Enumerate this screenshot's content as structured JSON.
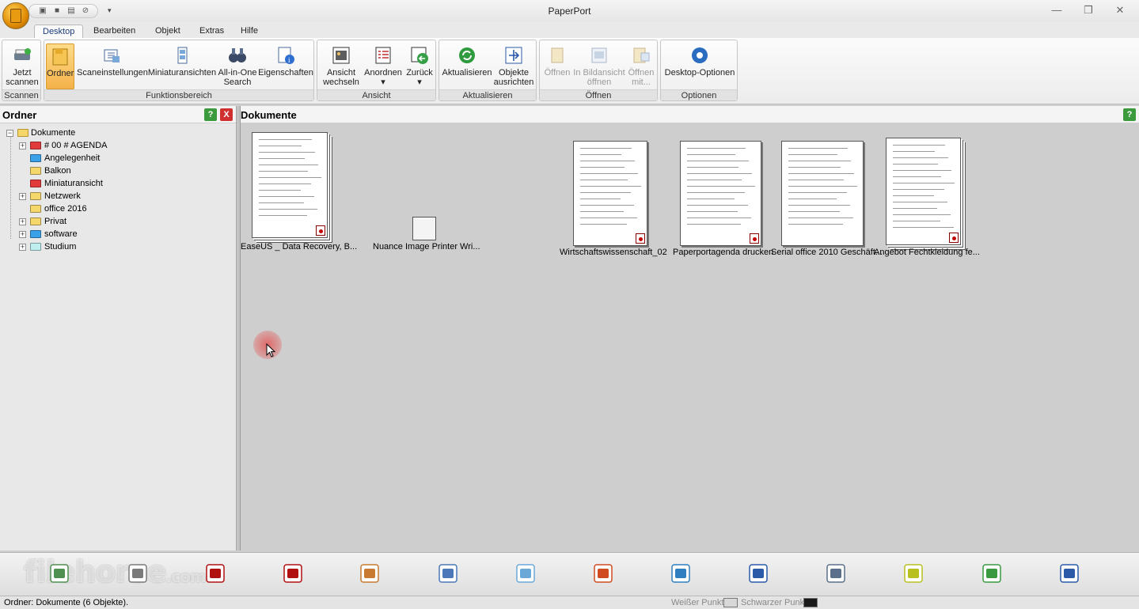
{
  "window": {
    "title": "PaperPort",
    "controls": [
      "minimize",
      "restore",
      "close"
    ]
  },
  "quick_access": {
    "icons": [
      "scan-icon",
      "folder-icon",
      "print-icon",
      "undo-icon"
    ],
    "more": "▾"
  },
  "ribbon": {
    "tabs": [
      {
        "label": "Desktop",
        "active": true
      },
      {
        "label": "Bearbeiten"
      },
      {
        "label": "Objekt"
      },
      {
        "label": "Extras"
      },
      {
        "label": "Hilfe"
      }
    ],
    "groups": {
      "scannen": {
        "label": "Scannen",
        "buttons": [
          {
            "label1": "Jetzt",
            "label2": "scannen"
          }
        ]
      },
      "funktionsbereich": {
        "label": "Funktionsbereich",
        "buttons": [
          {
            "label1": "Ordner",
            "selected": true
          },
          {
            "label1": "Scaneinstellungen"
          },
          {
            "label1": "Miniaturansichten"
          },
          {
            "label1": "All-in-One",
            "label2": "Search"
          },
          {
            "label1": "Eigenschaften"
          }
        ]
      },
      "ansicht": {
        "label": "Ansicht",
        "buttons": [
          {
            "label1": "Ansicht",
            "label2": "wechseln ▾"
          },
          {
            "label1": "Anordnen",
            "label2": "▾"
          },
          {
            "label1": "Zurück",
            "label2": "▾"
          }
        ]
      },
      "aktualisieren": {
        "label": "Aktualisieren",
        "buttons": [
          {
            "label1": "Aktualisieren"
          },
          {
            "label1": "Objekte",
            "label2": "ausrichten"
          }
        ]
      },
      "oeffnen": {
        "label": "Öffnen",
        "buttons": [
          {
            "label1": "Öffnen",
            "disabled": true
          },
          {
            "label1": "In Bildansicht",
            "label2": "öffnen",
            "disabled": true
          },
          {
            "label1": "Öffnen",
            "label2": "mit...",
            "disabled": true
          }
        ]
      },
      "optionen": {
        "label": "Optionen",
        "buttons": [
          {
            "label1": "Desktop-Optionen"
          }
        ]
      }
    }
  },
  "folder_pane": {
    "title": "Ordner",
    "help": "?",
    "close": "X",
    "root": {
      "label": "Dokumente",
      "expander": "−"
    },
    "items": [
      {
        "label": "# 00 # AGENDA",
        "color": "#e03a3a",
        "expander": "+"
      },
      {
        "label": "Angelegenheit",
        "color": "#3aa0e8",
        "expander": ""
      },
      {
        "label": "Balkon",
        "color": "#f4d66a",
        "expander": ""
      },
      {
        "label": "Miniaturansicht",
        "color": "#e03a3a",
        "expander": ""
      },
      {
        "label": "Netzwerk",
        "color": "#f4d66a",
        "expander": "+"
      },
      {
        "label": "office 2016",
        "color": "#f4d66a",
        "expander": ""
      },
      {
        "label": "Privat",
        "color": "#f4d66a",
        "expander": "+"
      },
      {
        "label": "software",
        "color": "#3aa0e8",
        "expander": "+"
      },
      {
        "label": "Studium",
        "color": "#bfeef0",
        "expander": "+"
      }
    ]
  },
  "doc_pane": {
    "title": "Dokumente",
    "help": "?",
    "documents": [
      {
        "caption": "EaseUS _ Data Recovery, B...",
        "type": "pdf-stack"
      },
      {
        "caption": "Nuance Image Printer Wri...",
        "type": "file"
      },
      {
        "caption": "Wirtschaftswissenschaft_02",
        "type": "pdf"
      },
      {
        "caption": "Paperportagenda drucken",
        "type": "pdf"
      },
      {
        "caption": "Serial office 2010 Geschäft...",
        "type": "doc"
      },
      {
        "caption": "Angebot Fechtkleidung fe...",
        "type": "pdf-stack"
      }
    ]
  },
  "send_to_bar": {
    "watermark": "filehorse",
    "watermark_suffix": ".com",
    "icons": [
      "scanner-app-icon",
      "satellite-dish-icon",
      "adobe-pdf-icon",
      "adobe-reader-icon",
      "paint-palette-icon",
      "text-document-icon",
      "notepad-icon",
      "powerpoint-icon",
      "globe-icon",
      "ftp-icon",
      "printer-icon",
      "hexagon-app-icon",
      "recycle-bin-icon",
      "image-converter-icon"
    ]
  },
  "status_bar": {
    "text": "Ordner: Dokumente (6 Objekte).",
    "white_dot_label": "Weißer Punkt",
    "black_dot_label": "Schwarzer Punkt",
    "white_color": "#d8d8d8",
    "black_color": "#1a1a1a"
  }
}
